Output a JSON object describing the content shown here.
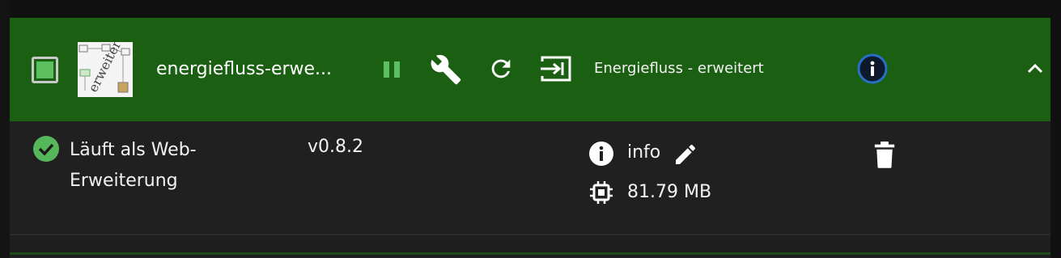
{
  "instance": {
    "title": "energiefluss-erwe...",
    "adapter_name": "Energiefluss - erweitert",
    "thumbnail_text": "erweitert",
    "status_text": "Läuft als Web-Erweiterung",
    "version": "v0.8.2",
    "log_level": "info",
    "memory": "81.79 MB",
    "enabled": true
  },
  "icons": {
    "pause": "pause-icon",
    "settings": "wrench-icon",
    "restart": "reload-icon",
    "open": "open-in-icon",
    "info": "info-circle-icon",
    "collapse": "chevron-up-icon",
    "status": "check-circle-icon",
    "log": "info-icon",
    "edit": "pencil-icon",
    "memory": "chip-icon",
    "delete": "trash-icon"
  },
  "colors": {
    "header_bg": "#1a5f12",
    "accent_green": "#5bbf5f",
    "info_ring": "#2a6fc7",
    "card_bg": "#202020"
  }
}
